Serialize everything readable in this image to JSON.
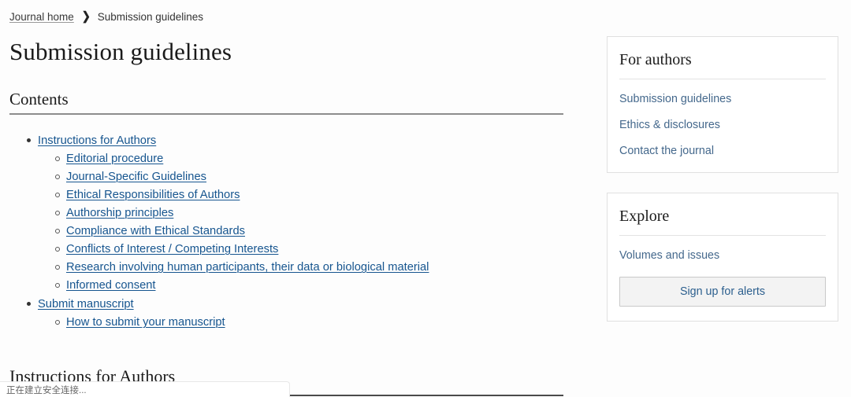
{
  "breadcrumb": {
    "home_label": "Journal home",
    "separator": "❯",
    "current_label": "Submission guidelines"
  },
  "main": {
    "page_title": "Submission guidelines",
    "contents_heading": "Contents",
    "section_heading": "Instructions for Authors",
    "toc": [
      {
        "label": "Instructions for Authors",
        "children": [
          "Editorial procedure",
          "Journal-Specific Guidelines",
          "Ethical Responsibilities of Authors",
          "Authorship principles",
          "Compliance with Ethical Standards",
          "Conflicts of Interest / Competing Interests",
          "Research involving human participants, their data or biological material",
          "Informed consent"
        ]
      },
      {
        "label": "Submit manuscript",
        "children": [
          "How to submit your manuscript"
        ]
      }
    ]
  },
  "sidebar": {
    "for_authors": {
      "title": "For authors",
      "links": [
        "Submission guidelines",
        "Ethics & disclosures",
        "Contact the journal"
      ]
    },
    "explore": {
      "title": "Explore",
      "links": [
        "Volumes and issues"
      ],
      "alerts_button_label": "Sign up for alerts"
    }
  },
  "status_bar": {
    "text": "正在建立安全连接..."
  },
  "colors": {
    "link_blue": "#16558f",
    "sidebar_link_blue": "#44688c",
    "button_text_blue": "#2c5f8e",
    "rule_gray": "#8d8d8d",
    "panel_border": "#e0e0e0"
  }
}
